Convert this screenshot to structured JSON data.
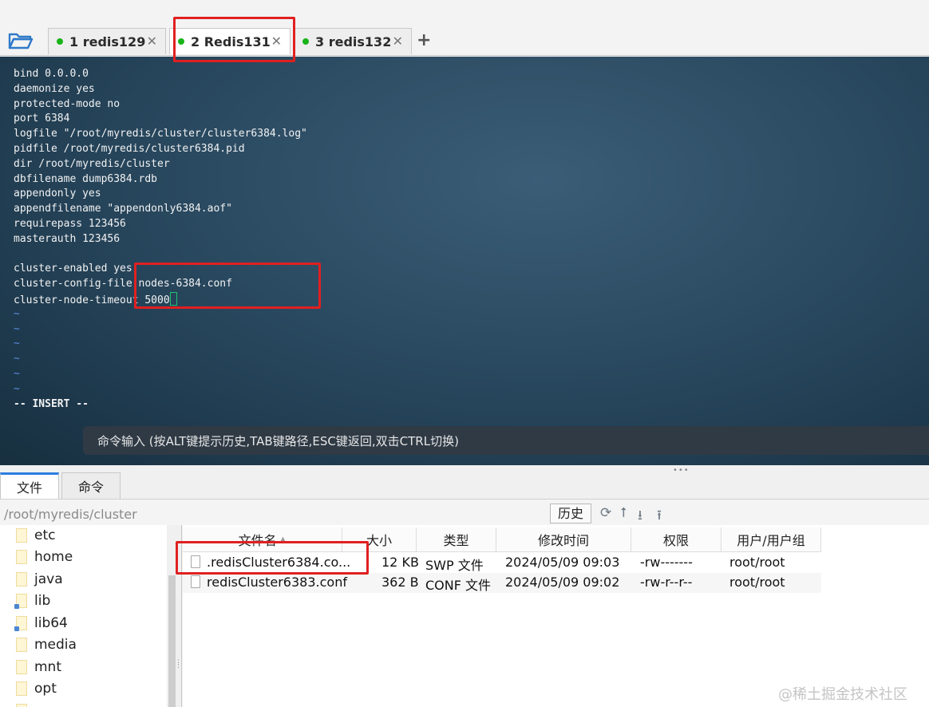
{
  "tabs": [
    {
      "num": "1",
      "label": "redis129"
    },
    {
      "num": "2",
      "label": "Redis131"
    },
    {
      "num": "3",
      "label": "redis132"
    }
  ],
  "tab_close": "✕",
  "tab_add": "+",
  "terminal": {
    "lines": [
      "bind 0.0.0.0",
      "daemonize yes",
      "protected-mode no",
      "port 6384",
      "logfile \"/root/myredis/cluster/cluster6384.log\"",
      "pidfile /root/myredis/cluster6384.pid",
      "dir /root/myredis/cluster",
      "dbfilename dump6384.rdb",
      "appendonly yes",
      "appendfilename \"appendonly6384.aof\"",
      "requirepass 123456",
      "masterauth 123456",
      "",
      "cluster-enabled yes",
      "cluster-config-file nodes-6384.conf",
      "cluster-node-timeout 5000"
    ],
    "tilde": "~",
    "mode": "-- INSERT --",
    "command_hint": "命令输入 (按ALT键提示历史,TAB键路径,ESC键返回,双击CTRL切换)"
  },
  "bottom_tabs": [
    "文件",
    "命令"
  ],
  "path": "/root/myredis/cluster",
  "history_button": "历史",
  "toolbar_icons": {
    "refresh": "⟳",
    "up": "⭡",
    "download": "⭳",
    "upload": "⭱"
  },
  "tree": [
    "etc",
    "home",
    "java",
    "lib",
    "lib64",
    "media",
    "mnt",
    "opt"
  ],
  "columns": [
    "文件名",
    "大小",
    "类型",
    "修改时间",
    "权限",
    "用户/用户组"
  ],
  "files": [
    {
      "name": ".redisCluster6384.co...",
      "size": "12 KB",
      "type": "SWP 文件",
      "mtime": "2024/05/09 09:03",
      "perm": "-rw-------",
      "owner": "root/root"
    },
    {
      "name": "redisCluster6383.conf",
      "size": "362 B",
      "type": "CONF 文件",
      "mtime": "2024/05/09 09:02",
      "perm": "-rw-r--r--",
      "owner": "root/root"
    }
  ],
  "watermark": "@稀土掘金技术社区",
  "colors": {
    "highlight": "#e02020",
    "status_dot": "#19b419",
    "active_tab_accent": "#2e7de0"
  }
}
